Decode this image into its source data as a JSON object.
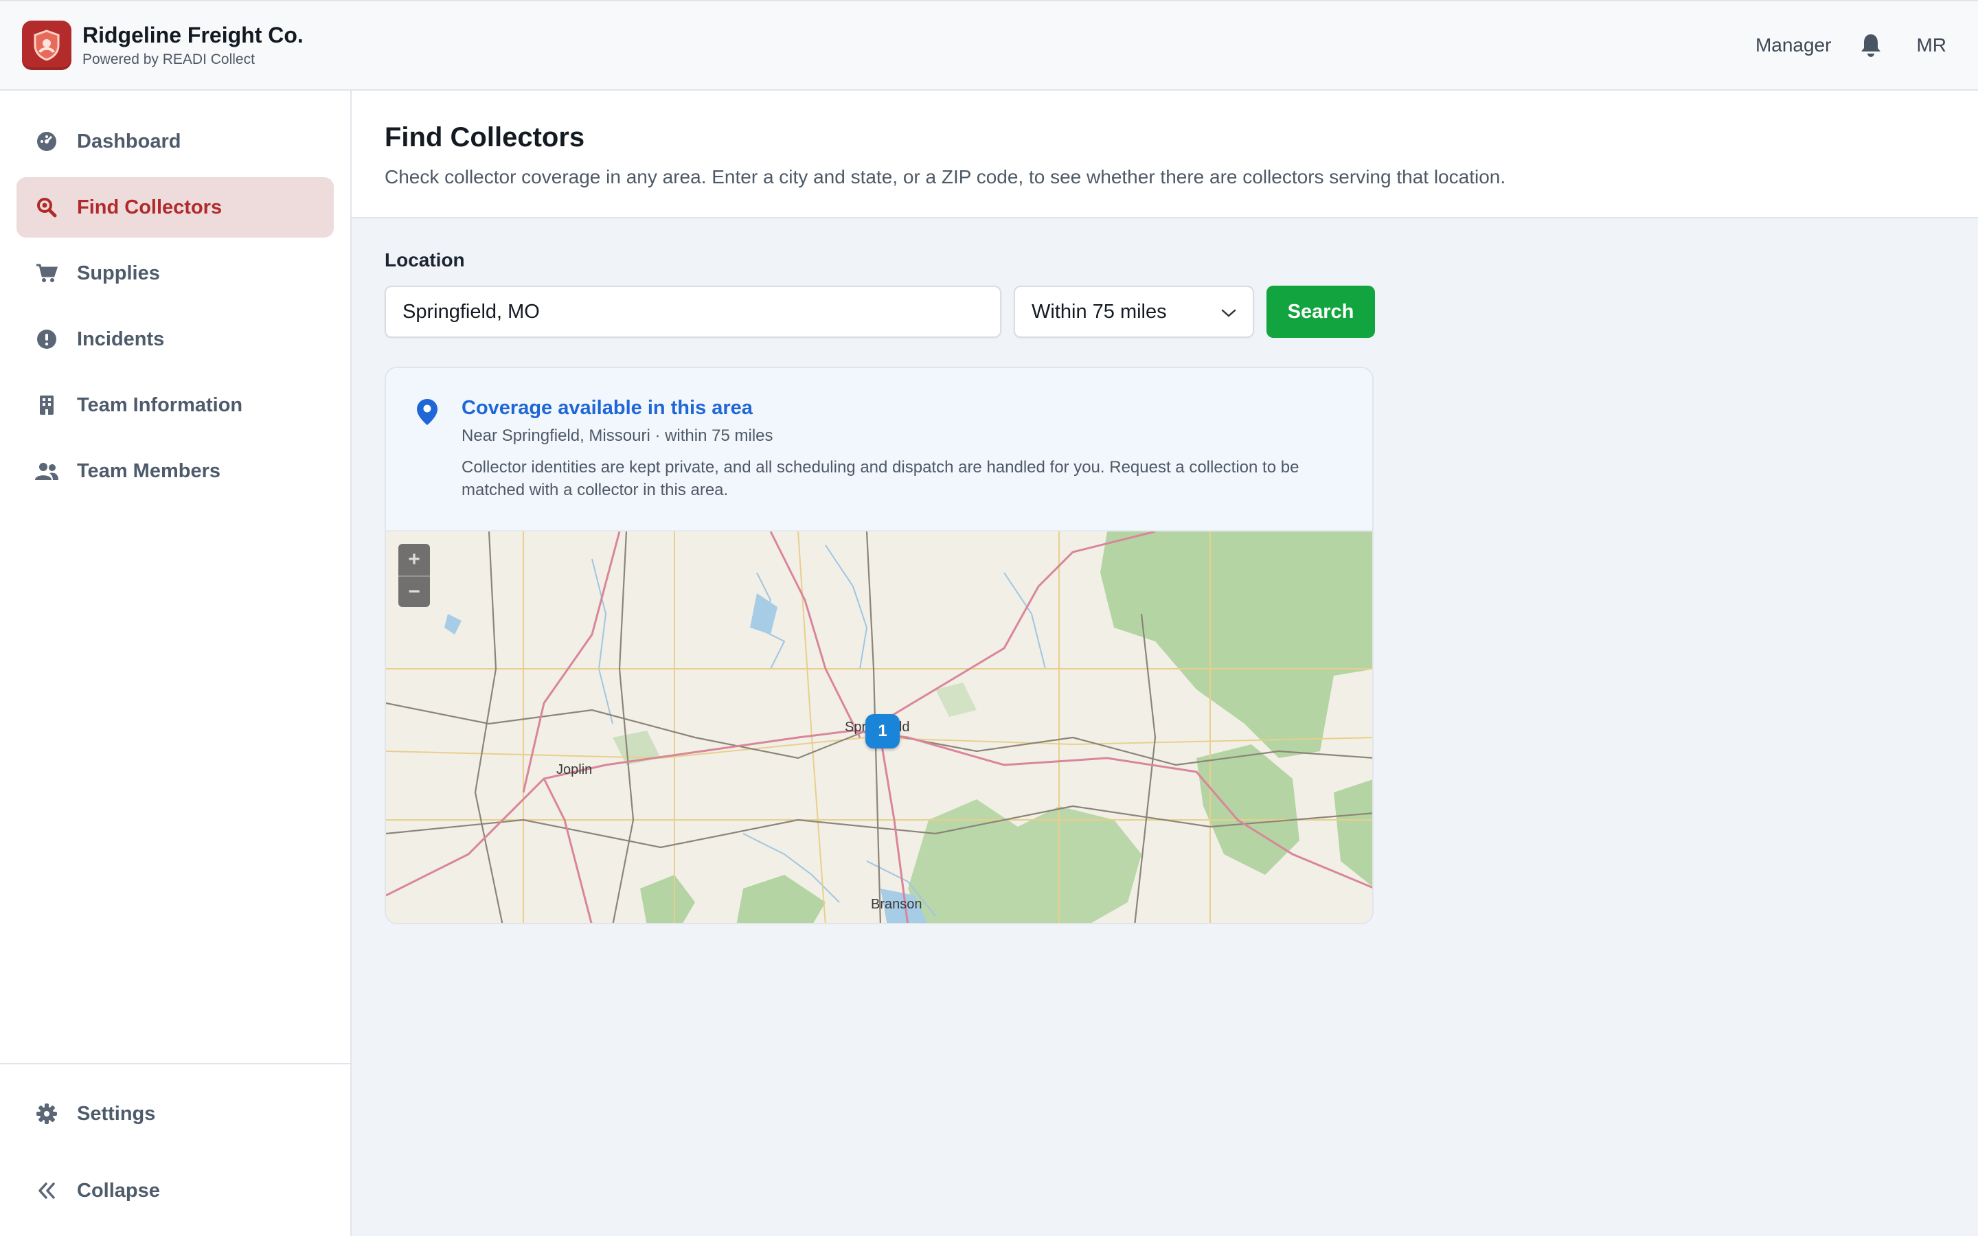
{
  "header": {
    "brand_name": "Ridgeline Freight Co.",
    "brand_sub": "Powered by READI Collect",
    "role": "Manager",
    "initials": "MR"
  },
  "sidebar": {
    "items": [
      {
        "label": "Dashboard",
        "icon": "dashboard-icon"
      },
      {
        "label": "Find Collectors",
        "icon": "search-icon",
        "active": true
      },
      {
        "label": "Supplies",
        "icon": "cart-icon"
      },
      {
        "label": "Incidents",
        "icon": "alert-icon"
      },
      {
        "label": "Team Information",
        "icon": "building-icon"
      },
      {
        "label": "Team Members",
        "icon": "users-icon"
      }
    ],
    "bottom": [
      {
        "label": "Settings",
        "icon": "gear-icon"
      },
      {
        "label": "Collapse",
        "icon": "chevrons-left-icon"
      }
    ]
  },
  "page": {
    "title": "Find Collectors",
    "description": "Check collector coverage in any area. Enter a city and state, or a ZIP code, to see whether there are collectors serving that location."
  },
  "search": {
    "label": "Location",
    "value": "Springfield, MO",
    "radius": "Within 75 miles",
    "button": "Search"
  },
  "result": {
    "title": "Coverage available in this area",
    "near": "Near Springfield, Missouri · within 75 miles",
    "note": "Collector identities are kept private, and all scheduling and dispatch are handled for you. Request a collection to be matched with a collector in this area."
  },
  "map": {
    "zoom_in": "+",
    "zoom_out": "−",
    "cities": {
      "springfield": "Springfield",
      "joplin": "Joplin",
      "branson": "Branson"
    },
    "marker_count": "1"
  },
  "colors": {
    "brand": "#b42b2b",
    "active_bg": "#eedcdc",
    "accent_blue": "#1f66d6",
    "search_green": "#12a53f",
    "marker_blue": "#1a84d8"
  }
}
